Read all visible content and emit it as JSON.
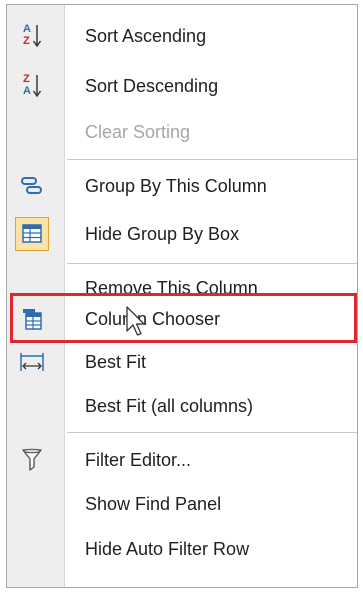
{
  "menu": {
    "items": [
      {
        "label": "Sort Ascending",
        "icon": "sort-ascending-icon",
        "enabled": true
      },
      {
        "label": "Sort Descending",
        "icon": "sort-descending-icon",
        "enabled": true
      },
      {
        "label": "Clear Sorting",
        "icon": null,
        "enabled": false
      },
      {
        "label": "Group By This Column",
        "icon": "group-by-column-icon",
        "enabled": true
      },
      {
        "label": "Hide Group By Box",
        "icon": "group-by-box-icon",
        "enabled": true,
        "checked": true
      },
      {
        "label": "Remove This Column",
        "icon": null,
        "enabled": true
      },
      {
        "label": "Column Chooser",
        "icon": "column-chooser-icon",
        "enabled": true,
        "highlighted": true
      },
      {
        "label": "Best Fit",
        "icon": "best-fit-icon",
        "enabled": true
      },
      {
        "label": "Best Fit (all columns)",
        "icon": null,
        "enabled": true
      },
      {
        "label": "Filter Editor...",
        "icon": "filter-icon",
        "enabled": true
      },
      {
        "label": "Show Find Panel",
        "icon": null,
        "enabled": true
      },
      {
        "label": "Hide Auto Filter Row",
        "icon": null,
        "enabled": true
      }
    ]
  },
  "icons": {
    "sort_ascending_top": "A",
    "sort_ascending_bottom": "Z",
    "sort_descending_top": "Z",
    "sort_descending_bottom": "A"
  },
  "colors": {
    "highlight_border": "#e0272b",
    "icon_blue": "#2e6db4",
    "icon_red": "#c8282c",
    "checked_bg": "#fbe3a6",
    "checked_border": "#e0a23a",
    "disabled_text": "#a6a6a6"
  }
}
